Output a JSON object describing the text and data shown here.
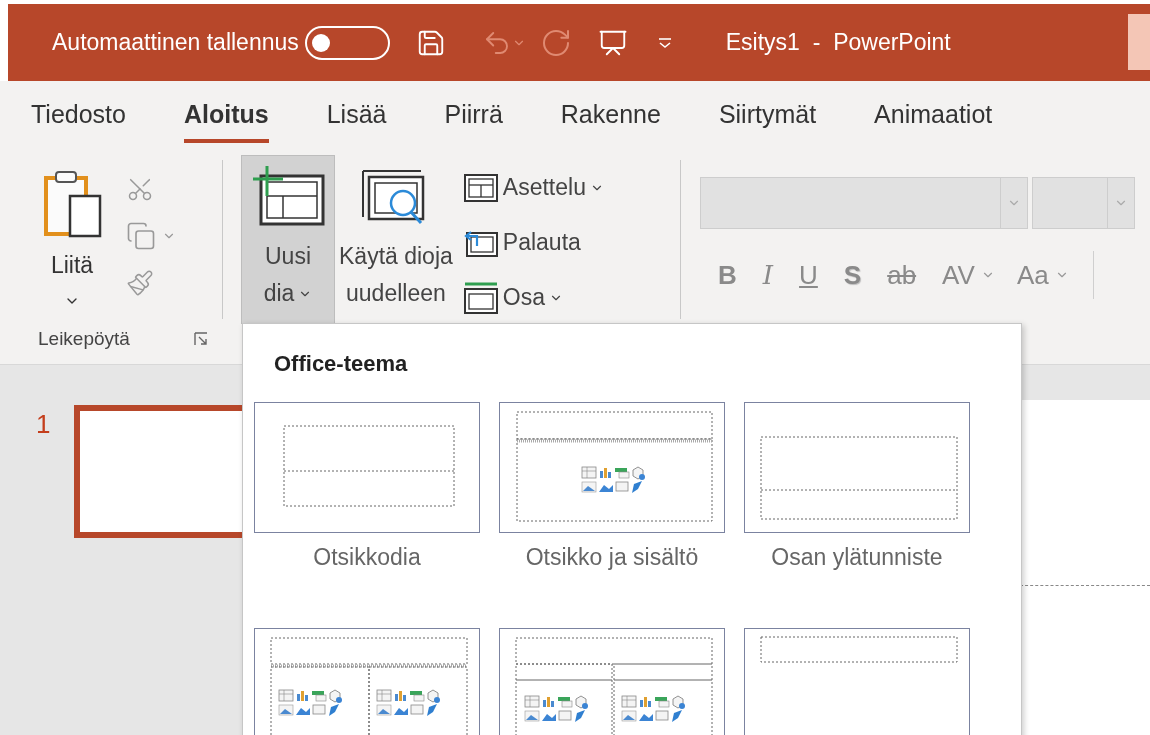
{
  "title_bar": {
    "autosave_label": "Automaattinen tallennus",
    "autosave_on": false,
    "title": "Esitys1  -  PowerPoint"
  },
  "tabs": [
    {
      "label": "Tiedosto",
      "selected": false
    },
    {
      "label": "Aloitus",
      "selected": true
    },
    {
      "label": "Lisää",
      "selected": false
    },
    {
      "label": "Piirrä",
      "selected": false
    },
    {
      "label": "Rakenne",
      "selected": false
    },
    {
      "label": "Siirtymät",
      "selected": false
    },
    {
      "label": "Animaatiot",
      "selected": false
    }
  ],
  "clipboard": {
    "paste": "Liitä",
    "group_label": "Leikepöytä"
  },
  "slides_group": {
    "new_slide": {
      "line1": "Uusi",
      "line2": "dia",
      "pressed": true
    },
    "reuse": {
      "line1": "Käytä dioja",
      "line2": "uudelleen"
    },
    "layout": "Asettelu",
    "reset": "Palauta",
    "section": "Osa"
  },
  "font_group": {
    "buttons": [
      {
        "kind": "bold",
        "label": "B"
      },
      {
        "kind": "italic",
        "label": "I"
      },
      {
        "kind": "underline",
        "label": "U"
      },
      {
        "kind": "shadow",
        "label": "S"
      },
      {
        "kind": "strike",
        "label": "ab"
      },
      {
        "kind": "spacing",
        "label": "AV"
      },
      {
        "kind": "case",
        "label": "Aa"
      }
    ]
  },
  "thumbnails": [
    {
      "number": "1",
      "selected": true
    }
  ],
  "layout_gallery": {
    "heading": "Office-teema",
    "layouts": [
      {
        "kind": "title",
        "name": "Otsikkodia"
      },
      {
        "kind": "title-content",
        "name": "Otsikko ja sisältö"
      },
      {
        "kind": "section",
        "name": "Osan ylätunniste"
      },
      {
        "kind": "two-content"
      },
      {
        "kind": "comparison"
      },
      {
        "kind": "title-only"
      }
    ]
  }
}
